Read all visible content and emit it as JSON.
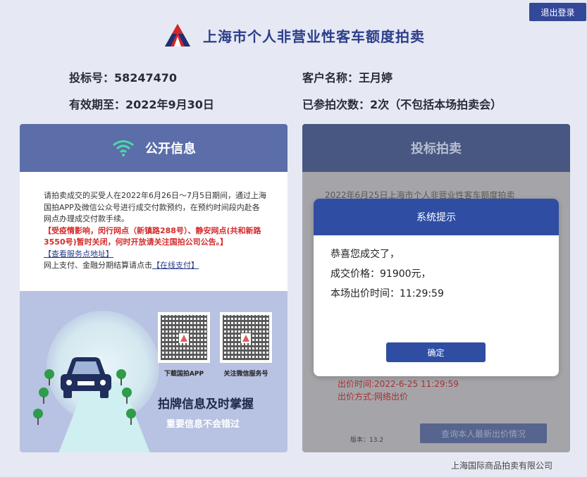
{
  "header": {
    "logout_label": "退出登录",
    "title": "上海市个人非营业性客车额度拍卖"
  },
  "info": {
    "bid_no": "投标号：58247470",
    "customer": "客户名称：王月婷",
    "valid_until": "有效期至：2022年9月30日",
    "participation": "已参拍次数：2次（不包括本场拍卖会）"
  },
  "public_info": {
    "title": "公开信息",
    "para1": "请拍卖成交的买受人在2022年6月26日～7月5日期间，通过上海国拍APP及微信公众号进行成交付款预约，在预约时间段内赴各网点办理成交付款手续。",
    "para_red": "【受疫情影响，闵行网点（新镇路288号）、静安网点(共和新路3550号)暂时关闭，何时开放请关注国拍公司公告。】",
    "view_outlets": "【查看服务点地址】",
    "online_pay_prefix": "网上支付、金融分期结算请点击",
    "online_pay_link": "【在线支付】",
    "qr_app_label": "下载国拍APP",
    "qr_wechat_label": "关注微信服务号",
    "slogan": "拍牌信息及时掌握",
    "slogan_sub": "重要信息不会错过"
  },
  "bidding": {
    "title": "投标拍卖",
    "behind_line": "2022年6月25日上海市个人非营业性客车额度拍卖",
    "bid_time": "出价时间:2022-6-25 11:29:59",
    "bid_method": "出价方式:网络出价",
    "version": "版本：13.2",
    "query_button": "查询本人最新出价情况"
  },
  "dialog": {
    "title": "系统提示",
    "line1": "恭喜您成交了，",
    "line2": "成交价格：91900元，",
    "line3": "本场出价时间：11:29:59",
    "ok_label": "确定"
  },
  "footer": "上海国际商品拍卖有限公司",
  "colors": {
    "brand_blue": "#2f4ea3",
    "header_blue": "#5b6ea9",
    "alert_red": "#d42a2a",
    "logo_red": "#d3252a"
  }
}
